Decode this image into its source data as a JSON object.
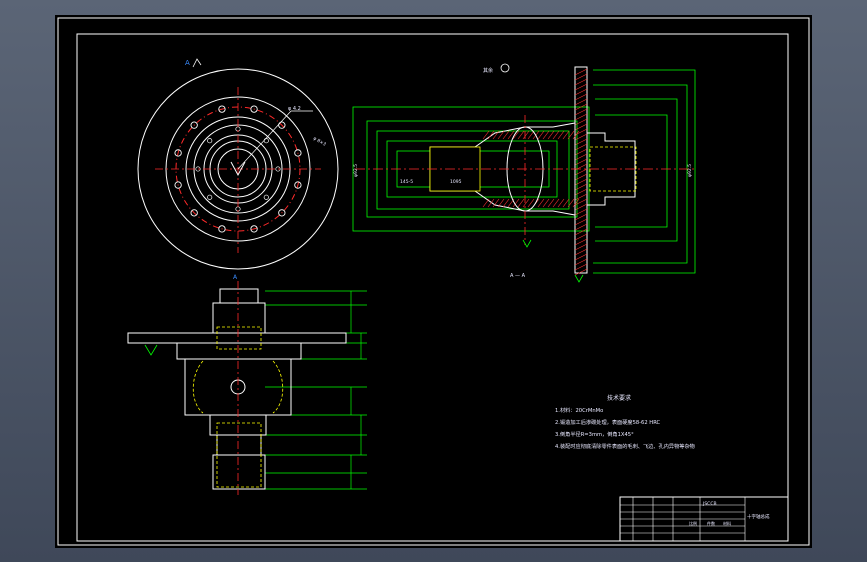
{
  "view": {
    "section_symbol": "A",
    "section_label": "A — A",
    "roughness_note": "其余",
    "callouts": {
      "bolt_circle": "φ 4.2",
      "pitch_circle": "φ 8×3",
      "section_dim_1": "145-5",
      "section_dim_2": "1095",
      "vertical_dim_left": "φ92.5",
      "vertical_dim_right": "φ92.5"
    }
  },
  "notes": {
    "title": "技术要求",
    "lines": [
      "1.材料：20CrMnMo",
      "2.锻造加工后渗碳处理，表面硬度58-62 HRC",
      "3.倒角半径R=3mm，倒角1X45°",
      "4.装配时应彻底清除零件表面的毛刺、飞边、孔内异物等杂物"
    ]
  },
  "title_block": {
    "part_name": "十字轴总成",
    "drawing_no": "JSCCB",
    "scale_label": "比例",
    "qty_label": "件数",
    "material_label": "材料"
  },
  "colors": {
    "paper": "#000000",
    "frame": "#ffffff",
    "outline": "#ffffff",
    "dimension": "#00ff00",
    "hidden": "#ffff00",
    "center": "#ff2a2a",
    "hatch": "#ff3030",
    "annotation": "#e8e8ff",
    "highlight": "#3a8cff"
  }
}
